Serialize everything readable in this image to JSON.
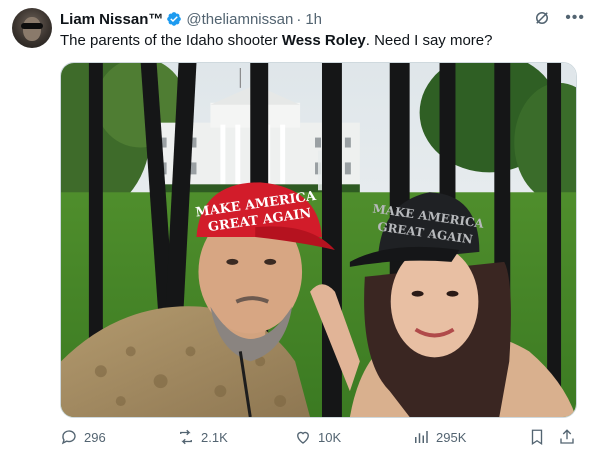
{
  "author": {
    "name": "Liam Nissan™",
    "handle": "@theliamnissan",
    "separator": "·",
    "time": "1h"
  },
  "tweet": {
    "text_before": "The parents of the Idaho shooter ",
    "text_bold": "Wess Roley",
    "text_after": ". Need I say more?"
  },
  "media": {
    "hat_left_text_1": "MAKE AMERICA",
    "hat_left_text_2": "GREAT AGAIN",
    "hat_right_text_1": "MAKE AMERICA",
    "hat_right_text_2": "GREAT AGAIN"
  },
  "actions": {
    "replies": "296",
    "reposts": "2.1K",
    "likes": "10K",
    "views": "295K"
  },
  "colors": {
    "accent_blue": "#1d9bf0",
    "muted": "#536471",
    "hat_red": "#d21c2a",
    "hat_black": "#1f2124"
  }
}
